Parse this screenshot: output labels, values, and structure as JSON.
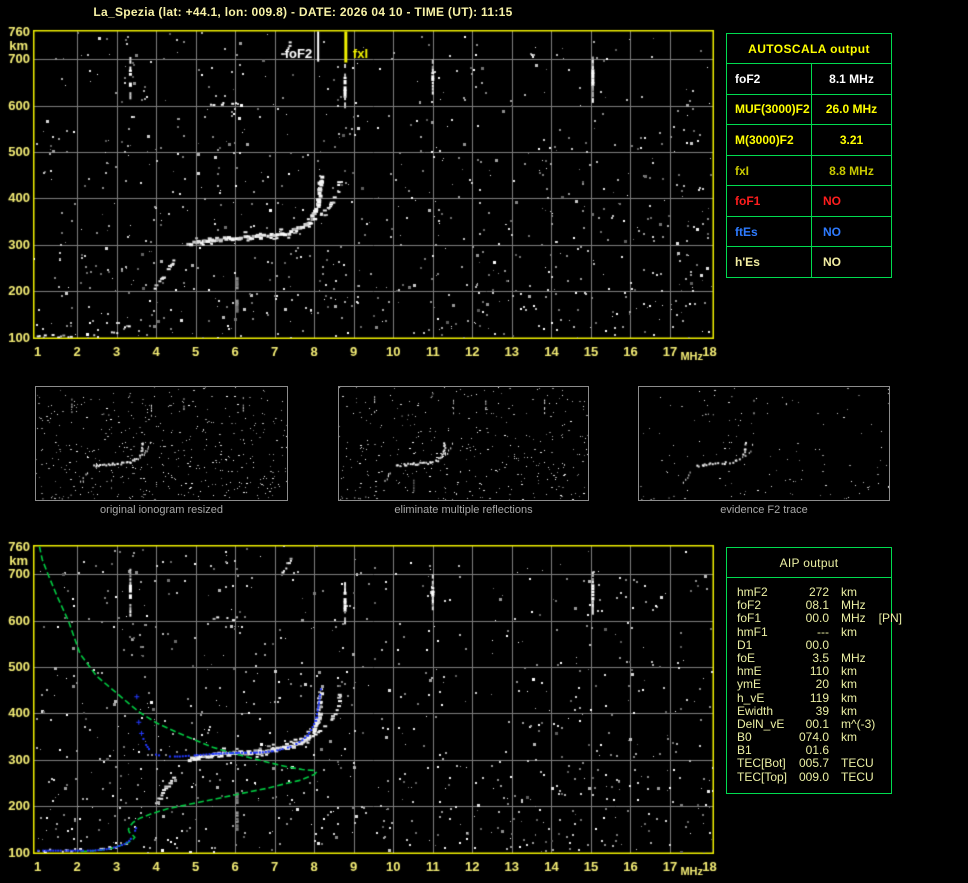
{
  "title": "La_Spezia (lat: +44.1, lon: 009.8) - DATE: 2026 04 10 - TIME (UT): 11:15",
  "colors": {
    "axis_yellow": "#f3ec74",
    "border_yellow": "#f0f000",
    "grid_gray": "#7d7d7d",
    "table_green": "#00dc50",
    "profile_green": "#00c840",
    "trace_blue": "#2238ff",
    "pale_yellow": "#ecf0a4"
  },
  "autoscala_table": {
    "header": "AUTOSCALA output",
    "rows": [
      {
        "param": "foF2",
        "value": "8.1 MHz",
        "color": "#ffffff"
      },
      {
        "param": "MUF(3000)F2",
        "value": "26.0 MHz",
        "color": "#ffff00"
      },
      {
        "param": "M(3000)F2",
        "value": "3.21",
        "color": "#ffff00"
      },
      {
        "param": "fxI",
        "value": "8.8 MHz",
        "color": "#c9c900"
      },
      {
        "param": "foF1",
        "value": "NO",
        "color": "#ff1e1e"
      },
      {
        "param": "ftEs",
        "value": "NO",
        "color": "#2e7bff"
      },
      {
        "param": "h'Es",
        "value": "NO",
        "color": "#f2eda2"
      }
    ]
  },
  "aip_table": {
    "header": "AIP output",
    "rows": [
      {
        "param": "hmF2",
        "value": "272",
        "unit": "km",
        "note": ""
      },
      {
        "param": "foF2",
        "value": "08.1",
        "unit": "MHz",
        "note": ""
      },
      {
        "param": "foF1",
        "value": "00.0",
        "unit": "MHz",
        "note": "[PN]"
      },
      {
        "param": "hmF1",
        "value": "---",
        "unit": "km",
        "note": ""
      },
      {
        "param": "D1",
        "value": "00.0",
        "unit": "",
        "note": ""
      },
      {
        "param": "foE",
        "value": "3.5",
        "unit": "MHz",
        "note": ""
      },
      {
        "param": "hmE",
        "value": "110",
        "unit": "km",
        "note": ""
      },
      {
        "param": "ymE",
        "value": "20",
        "unit": "km",
        "note": ""
      },
      {
        "param": "h_vE",
        "value": "119",
        "unit": "km",
        "note": ""
      },
      {
        "param": "Ewidth",
        "value": "39",
        "unit": "km",
        "note": ""
      },
      {
        "param": "DelN_vE",
        "value": "00.1",
        "unit": "m^(-3)",
        "note": ""
      },
      {
        "param": "B0",
        "value": "074.0",
        "unit": "km",
        "note": ""
      },
      {
        "param": "B1",
        "value": "01.6",
        "unit": "",
        "note": ""
      },
      {
        "param": "TEC[Bot]",
        "value": "005.7",
        "unit": "TECU",
        "note": ""
      },
      {
        "param": "TEC[Top]",
        "value": "009.0",
        "unit": "TECU",
        "note": ""
      }
    ]
  },
  "thumbnails": [
    {
      "caption": "original ionogram resized",
      "noise_count": 540,
      "trace_gain": 1.0,
      "streak_gain": 1.0
    },
    {
      "caption": "eliminate multiple reflections",
      "noise_count": 440,
      "trace_gain": 1.0,
      "streak_gain": 0.9
    },
    {
      "caption": "evidence F2 trace",
      "noise_count": 150,
      "trace_gain": 0.85,
      "streak_gain": 0.3
    }
  ],
  "chart_data": [
    {
      "id": "ionogram_top",
      "type": "scatter",
      "title": "autoscaled ionogram",
      "xlabel": "MHz",
      "ylabel": "km",
      "xlim": [
        1,
        18
      ],
      "ylim": [
        100,
        760
      ],
      "xticks": [
        1,
        2,
        3,
        4,
        5,
        6,
        7,
        8,
        9,
        10,
        11,
        12,
        13,
        14,
        15,
        16,
        17,
        18
      ],
      "yticks": [
        760,
        700,
        600,
        500,
        400,
        300,
        200,
        100
      ],
      "grid": true,
      "markers": [
        {
          "label": "foF2",
          "f": 8.1,
          "line_bottom_km": 695,
          "color": "#ffffff",
          "label_side": "left",
          "width": 2
        },
        {
          "label": "fxI",
          "f": 8.8,
          "line_bottom_km": 693,
          "color": "#f0f000",
          "label_side": "right",
          "width": 3
        }
      ],
      "echo_trace": [
        {
          "name": "E-region-echoes",
          "pts": [
            [
              1.02,
              102
            ],
            [
              1.35,
              103
            ],
            [
              2.5,
              106
            ],
            [
              2.8,
              109
            ],
            [
              3.05,
              114
            ],
            [
              3.25,
              121
            ],
            [
              3.45,
              133
            ]
          ],
          "size": 2,
          "density": 0.3
        },
        {
          "name": "F-lower-diagonal",
          "pts": [
            [
              4.0,
              206
            ],
            [
              4.25,
              236
            ],
            [
              4.5,
              268
            ]
          ],
          "size": 3,
          "density": 0.8
        },
        {
          "name": "F2-main-trace",
          "pts": [
            [
              4.85,
              300
            ],
            [
              5.3,
              309
            ],
            [
              5.9,
              313
            ],
            [
              6.5,
              316
            ],
            [
              7.0,
              320
            ],
            [
              7.35,
              326
            ],
            [
              7.65,
              336
            ],
            [
              7.9,
              350
            ],
            [
              8.02,
              365
            ],
            [
              8.1,
              385
            ],
            [
              8.15,
              415
            ],
            [
              8.18,
              448
            ]
          ],
          "size": 4,
          "density": 0.95
        },
        {
          "name": "F2-x-branch",
          "pts": [
            [
              7.55,
              332
            ],
            [
              7.95,
              349
            ],
            [
              8.25,
              367
            ],
            [
              8.5,
              394
            ],
            [
              8.62,
              420
            ],
            [
              8.68,
              448
            ]
          ],
          "size": 3,
          "density": 0.65
        },
        {
          "name": "high-echo-600km",
          "pts": [
            [
              5.25,
              601
            ],
            [
              5.55,
              604
            ],
            [
              5.85,
              602
            ],
            [
              6.1,
              605
            ]
          ],
          "size": 2,
          "density": 0.45
        },
        {
          "name": "high-echo-720km",
          "pts": [
            [
              7.2,
              706
            ],
            [
              7.45,
              740
            ]
          ],
          "size": 2,
          "density": 0.7
        }
      ],
      "rfi_streaks": [
        {
          "f": 3.35,
          "km": [
            610,
            712
          ],
          "bright": true
        },
        {
          "f": 8.78,
          "km": [
            598,
            690
          ],
          "bright": true
        },
        {
          "f": 11.0,
          "km": [
            630,
            700
          ],
          "bright": true
        },
        {
          "f": 15.05,
          "km": [
            615,
            706
          ],
          "bright": true
        },
        {
          "f": 6.05,
          "km": [
            150,
            230
          ],
          "bright": false
        }
      ],
      "noise_bands": [
        3.35,
        6.05,
        8.78,
        11.0,
        15.05
      ],
      "noise_count": 2100
    },
    {
      "id": "profile_bottom",
      "type": "line",
      "title": "AIP electron density profile over ionogram",
      "xlabel": "MHz",
      "ylabel": "km",
      "xlim": [
        1,
        18
      ],
      "ylim": [
        100,
        760
      ],
      "xticks": [
        1,
        2,
        3,
        4,
        5,
        6,
        7,
        8,
        9,
        10,
        11,
        12,
        13,
        14,
        15,
        16,
        17,
        18
      ],
      "yticks": [
        760,
        700,
        600,
        500,
        400,
        300,
        200,
        100
      ],
      "grid": true,
      "green_profile_points": [
        [
          1.05,
          760
        ],
        [
          1.12,
          732
        ],
        [
          1.28,
          697
        ],
        [
          1.5,
          652
        ],
        [
          1.78,
          600
        ],
        [
          2.08,
          528
        ],
        [
          2.5,
          480
        ],
        [
          2.96,
          447
        ],
        [
          3.3,
          422
        ],
        [
          3.59,
          402
        ],
        [
          4.0,
          380
        ],
        [
          4.5,
          360
        ],
        [
          5.0,
          342
        ],
        [
          5.43,
          327
        ],
        [
          5.95,
          314
        ],
        [
          6.43,
          303
        ],
        [
          6.9,
          293
        ],
        [
          7.36,
          284
        ],
        [
          7.7,
          279
        ],
        [
          8.0,
          277
        ],
        [
          8.05,
          273
        ],
        [
          8.0,
          268
        ],
        [
          7.61,
          255
        ],
        [
          7.2,
          247
        ],
        [
          6.78,
          238
        ],
        [
          6.2,
          228
        ],
        [
          5.53,
          216
        ],
        [
          4.9,
          205
        ],
        [
          4.27,
          194
        ],
        [
          3.9,
          184
        ],
        [
          3.59,
          174
        ],
        [
          3.42,
          165
        ],
        [
          3.34,
          157
        ],
        [
          3.3,
          150
        ],
        [
          3.32,
          144
        ],
        [
          3.4,
          138
        ],
        [
          3.46,
          133
        ],
        [
          3.4,
          127
        ],
        [
          3.28,
          121
        ],
        [
          3.1,
          115
        ],
        [
          2.88,
          109
        ],
        [
          2.6,
          105
        ],
        [
          2.3,
          103
        ],
        [
          2.0,
          102
        ]
      ],
      "blue_e_trace": [
        [
          1.02,
          104
        ],
        [
          2.4,
          104
        ],
        [
          2.75,
          107
        ],
        [
          3.0,
          112
        ],
        [
          3.2,
          118
        ],
        [
          3.32,
          125
        ],
        [
          3.4,
          134
        ],
        [
          3.47,
          147
        ],
        [
          3.52,
          158
        ]
      ],
      "blue_f_trace": [
        [
          3.68,
          345
        ],
        [
          3.75,
          332
        ],
        [
          3.82,
          323
        ],
        [
          3.9,
          316
        ],
        [
          4.0,
          311
        ],
        [
          4.15,
          308
        ],
        [
          4.35,
          307
        ],
        [
          4.6,
          307
        ],
        [
          4.9,
          309
        ],
        [
          5.2,
          311
        ],
        [
          5.5,
          313
        ],
        [
          5.8,
          314
        ],
        [
          6.1,
          315
        ],
        [
          6.4,
          315
        ],
        [
          6.7,
          316
        ],
        [
          7.0,
          319
        ],
        [
          7.2,
          323
        ],
        [
          7.4,
          328
        ],
        [
          7.55,
          334
        ],
        [
          7.7,
          342
        ],
        [
          7.82,
          352
        ],
        [
          7.92,
          364
        ],
        [
          8.0,
          377
        ],
        [
          8.05,
          391
        ],
        [
          8.09,
          406
        ],
        [
          8.12,
          422
        ],
        [
          8.15,
          440
        ],
        [
          8.18,
          458
        ]
      ],
      "blue_plus_points": [
        [
          3.5,
          437
        ],
        [
          3.55,
          382
        ],
        [
          3.62,
          358
        ]
      ]
    }
  ]
}
